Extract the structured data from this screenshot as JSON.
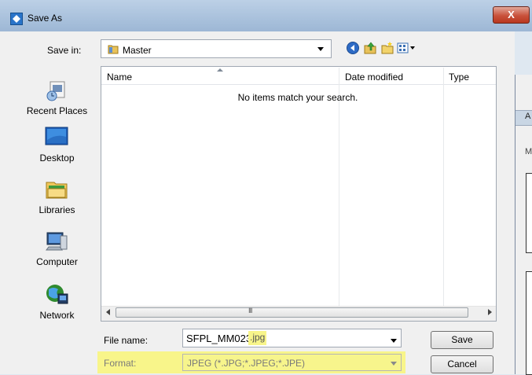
{
  "window": {
    "title": "Save As",
    "close_label": "X"
  },
  "save_in": {
    "label": "Save in:",
    "value": "Master"
  },
  "toolbar": {
    "icons": [
      "back-icon",
      "up-folder-icon",
      "new-folder-icon",
      "view-menu-icon"
    ]
  },
  "places": [
    {
      "label": "Recent Places",
      "icon": "recent-places-icon"
    },
    {
      "label": "Desktop",
      "icon": "desktop-icon"
    },
    {
      "label": "Libraries",
      "icon": "libraries-icon"
    },
    {
      "label": "Computer",
      "icon": "computer-icon"
    },
    {
      "label": "Network",
      "icon": "network-icon"
    }
  ],
  "file_list": {
    "columns": [
      "Name",
      "Date modified",
      "Type"
    ],
    "empty_message": "No items match your search.",
    "scroll_grip": "III"
  },
  "file_name": {
    "label": "File name:",
    "value_base": "SFPL_MM023",
    "value_ext": ".jpg"
  },
  "format": {
    "label": "Format:",
    "value": "JPEG (*.JPG;*.JPEG;*.JPE)"
  },
  "buttons": {
    "save": "Save",
    "cancel": "Cancel"
  },
  "background_window": {
    "label_top": "A",
    "label_mid": "M"
  },
  "colors": {
    "highlight": "#f8f58a",
    "titlebar": "#a9c1dc",
    "dialog": "#f0f0f0"
  }
}
